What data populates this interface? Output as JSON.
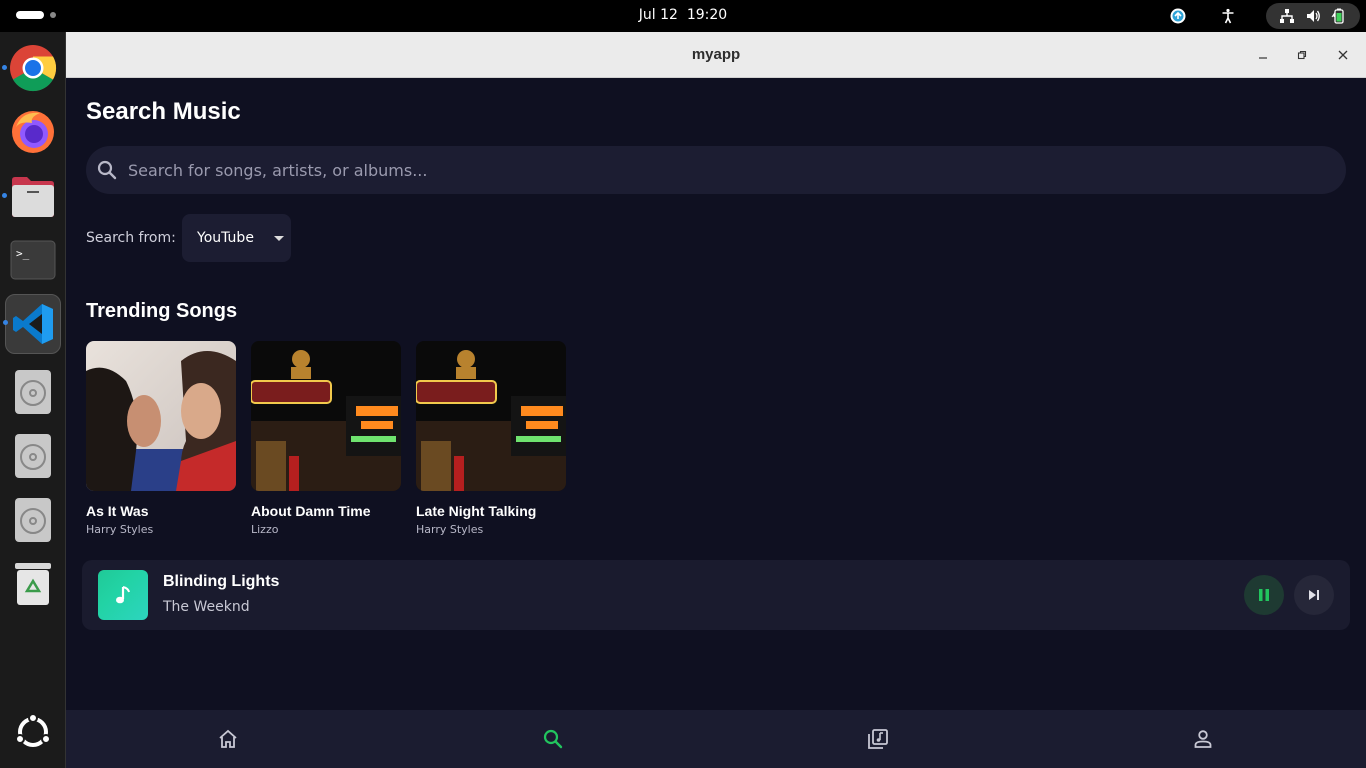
{
  "system": {
    "date": "Jul 12",
    "time": "19:20"
  },
  "dock": {
    "items": [
      "chrome",
      "firefox",
      "files",
      "terminal",
      "vscode",
      "disc-1",
      "disc-2",
      "disc-3",
      "trash",
      "show-apps"
    ]
  },
  "window": {
    "title": "myapp"
  },
  "search": {
    "heading": "Search Music",
    "placeholder": "Search for songs, artists, or albums...",
    "source_label": "Search from:",
    "source_value": "YouTube"
  },
  "trending": {
    "heading": "Trending Songs",
    "songs": [
      {
        "title": "As It Was",
        "artist": "Harry Styles"
      },
      {
        "title": "About Damn Time",
        "artist": "Lizzo"
      },
      {
        "title": "Late Night Talking",
        "artist": "Harry Styles"
      }
    ]
  },
  "now_playing": {
    "title": "Blinding Lights",
    "artist": "The Weeknd",
    "state": "playing",
    "accent": "#22c55e"
  },
  "nav": {
    "items": [
      "home",
      "search",
      "library",
      "profile"
    ],
    "active": "search",
    "active_color": "#22c55e"
  }
}
